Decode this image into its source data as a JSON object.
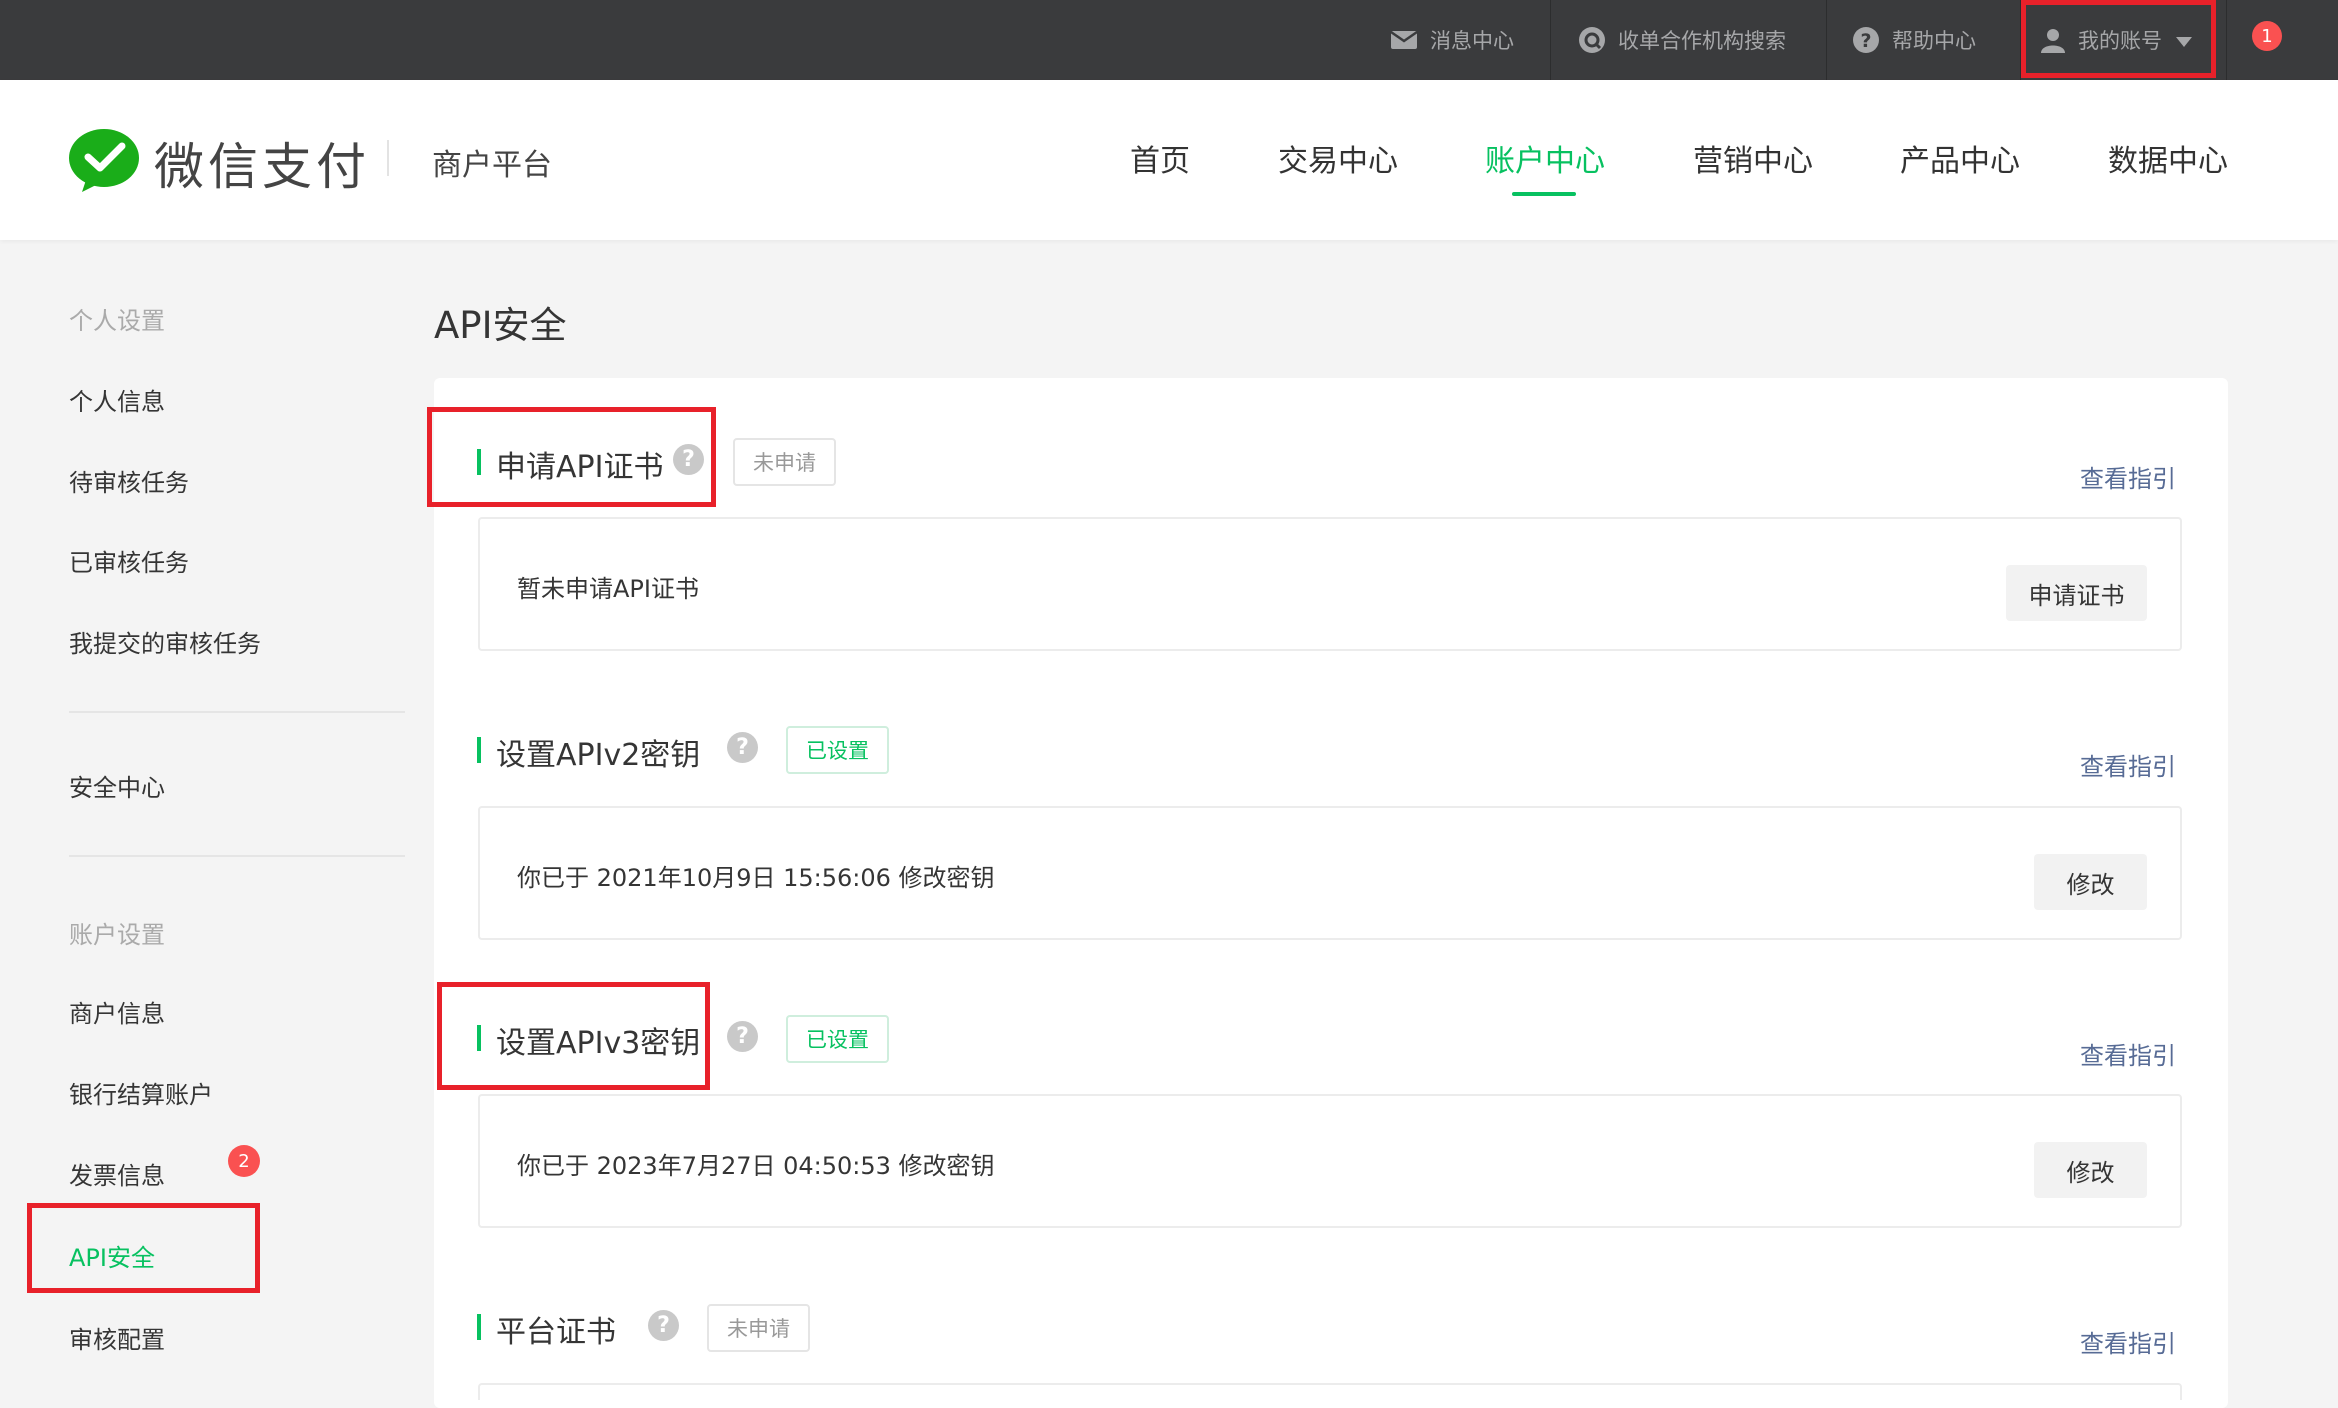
{
  "topbar": {
    "messages": "消息中心",
    "search_org": "收单合作机构搜索",
    "help": "帮助中心",
    "account": "我的账号",
    "notification_count": "1"
  },
  "header": {
    "brand": "微信支付",
    "platform": "商户平台",
    "nav": [
      "首页",
      "交易中心",
      "账户中心",
      "营销中心",
      "产品中心",
      "数据中心"
    ],
    "active_nav": "账户中心"
  },
  "sidebar": {
    "group_personal": "个人设置",
    "personal_items": [
      "个人信息",
      "待审核任务",
      "已审核任务",
      "我提交的审核任务"
    ],
    "security_center": "安全中心",
    "group_account": "账户设置",
    "account_items": [
      "商户信息",
      "银行结算账户",
      "发票信息",
      "API安全",
      "审核配置"
    ],
    "invoice_badge": "2",
    "active_item": "API安全"
  },
  "main": {
    "title": "API安全",
    "sections": [
      {
        "title": "申请API证书",
        "status": "未申请",
        "guide": "查看指引",
        "text": "暂未申请API证书",
        "button": "申请证书"
      },
      {
        "title": "设置APIv2密钥",
        "status": "已设置",
        "guide": "查看指引",
        "text": "你已于 2021年10月9日 15:56:06 修改密钥",
        "button": "修改"
      },
      {
        "title": "设置APIv3密钥",
        "status": "已设置",
        "guide": "查看指引",
        "text": "你已于 2023年7月27日 04:50:53 修改密钥",
        "button": "修改"
      },
      {
        "title": "平台证书",
        "status": "未申请",
        "guide": "查看指引"
      }
    ]
  },
  "colors": {
    "accent": "#07c160",
    "link": "#576b95",
    "highlight": "#e8212a",
    "badge": "#fa5151"
  }
}
